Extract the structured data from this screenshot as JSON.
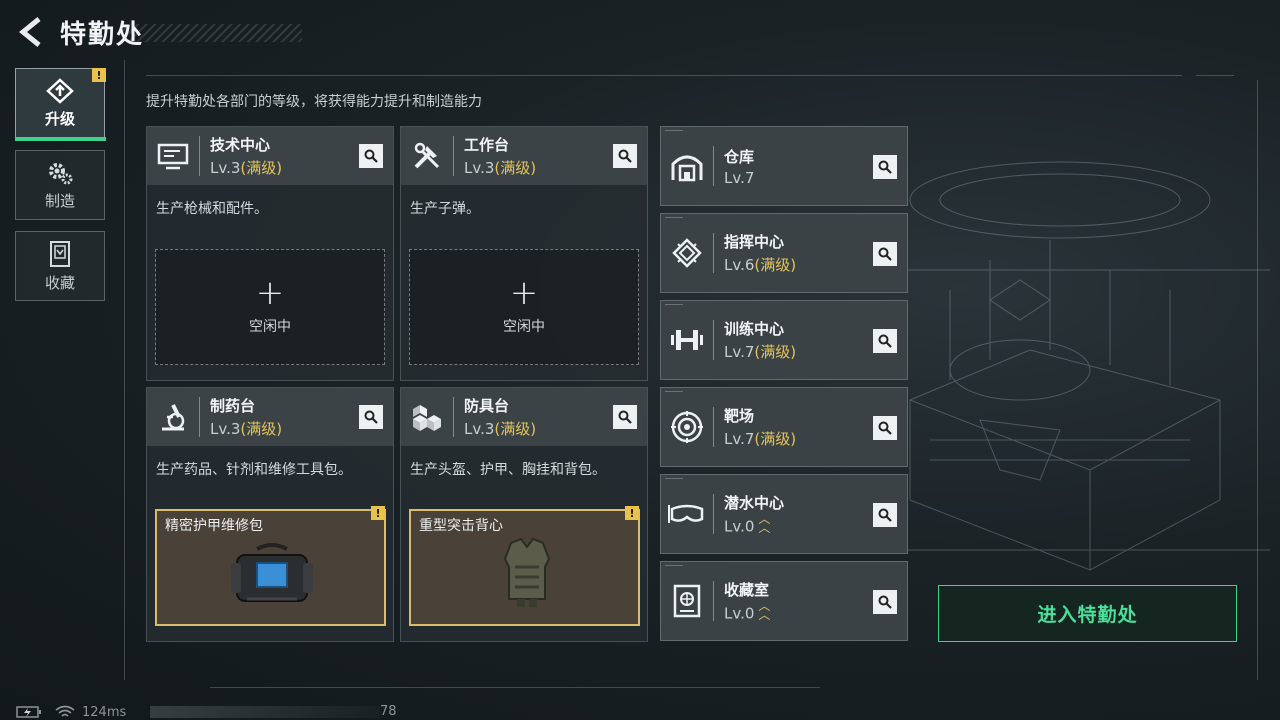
{
  "header": {
    "title": "特勤处"
  },
  "subtitle": "提升特勤处各部门的等级，将获得能力提升和制造能力",
  "nav": [
    {
      "label": "升级",
      "icon": "upgrade-icon",
      "active": true,
      "badge": "!"
    },
    {
      "label": "制造",
      "icon": "gears-icon",
      "active": false
    },
    {
      "label": "收藏",
      "icon": "collection-icon",
      "active": false
    }
  ],
  "main_cards": [
    {
      "name": "技术中心",
      "level": "Lv.3",
      "maxed_label": "(满级)",
      "icon": "monitor-icon",
      "desc": "生产枪械和配件。",
      "slot_label": "空闲中"
    },
    {
      "name": "工作台",
      "level": "Lv.3",
      "maxed_label": "(满级)",
      "icon": "tools-icon",
      "desc": "生产子弹。",
      "slot_label": "空闲中"
    },
    {
      "name": "制药台",
      "level": "Lv.3",
      "maxed_label": "(满级)",
      "icon": "microscope-icon",
      "desc": "生产药品、针剂和维修工具包。",
      "item_name": "精密护甲维修包",
      "badge": "!"
    },
    {
      "name": "防具台",
      "level": "Lv.3",
      "maxed_label": "(满级)",
      "icon": "cubes-icon",
      "desc": "生产头盔、护甲、胸挂和背包。",
      "item_name": "重型突击背心",
      "badge": "!"
    }
  ],
  "facilities": [
    {
      "name": "仓库",
      "level": "Lv.7",
      "maxed_label": "",
      "icon": "warehouse-icon"
    },
    {
      "name": "指挥中心",
      "level": "Lv.6",
      "maxed_label": "(满级)",
      "icon": "chip-icon"
    },
    {
      "name": "训练中心",
      "level": "Lv.7",
      "maxed_label": "(满级)",
      "icon": "dumbbell-icon"
    },
    {
      "name": "靶场",
      "level": "Lv.7",
      "maxed_label": "(满级)",
      "icon": "target-icon"
    },
    {
      "name": "潜水中心",
      "level": "Lv.0",
      "maxed_label": "",
      "icon": "goggles-icon"
    },
    {
      "name": "收藏室",
      "level": "Lv.0",
      "maxed_label": "",
      "icon": "vault-icon"
    }
  ],
  "enter_button": "进入特勤处",
  "status": {
    "ping": "124ms",
    "value": "78"
  },
  "colors": {
    "accent_green": "#3fd18d",
    "gold": "#e3c35a"
  }
}
